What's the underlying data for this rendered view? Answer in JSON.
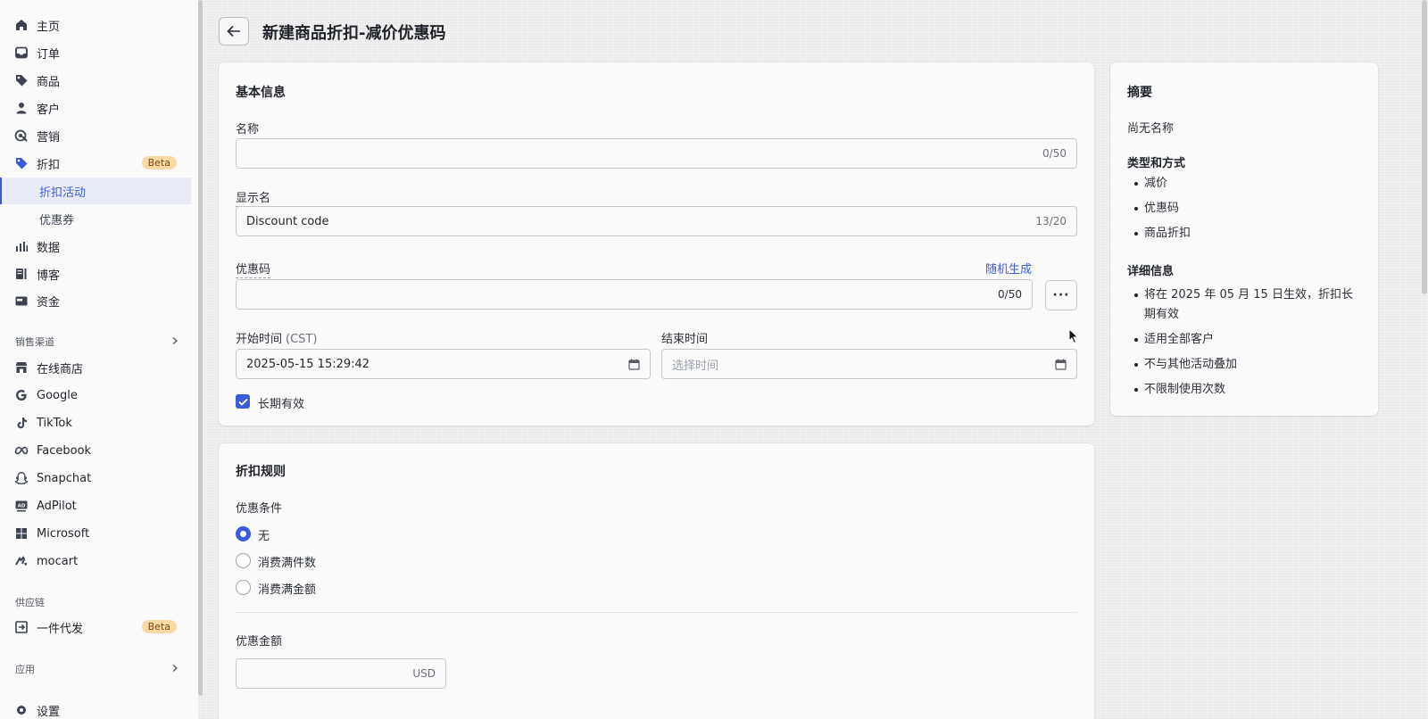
{
  "sidebar": {
    "items": [
      {
        "label": "主页",
        "icon": "home-icon"
      },
      {
        "label": "订单",
        "icon": "inbox-icon"
      },
      {
        "label": "商品",
        "icon": "tag-icon"
      },
      {
        "label": "客户",
        "icon": "person-icon"
      },
      {
        "label": "营销",
        "icon": "target-icon"
      },
      {
        "label": "折扣",
        "icon": "discount-tag-icon",
        "badge": "Beta"
      },
      {
        "label": "折扣活动",
        "active": true
      },
      {
        "label": "优惠券"
      },
      {
        "label": "数据",
        "icon": "bar-chart-icon"
      },
      {
        "label": "博客",
        "icon": "blog-icon"
      },
      {
        "label": "资金",
        "icon": "wallet-icon"
      }
    ],
    "sales_channels_label": "销售渠道",
    "channels": [
      {
        "label": "在线商店",
        "icon": "store-icon"
      },
      {
        "label": "Google",
        "icon": "google-icon"
      },
      {
        "label": "TikTok",
        "icon": "tiktok-icon"
      },
      {
        "label": "Facebook",
        "icon": "meta-icon"
      },
      {
        "label": "Snapchat",
        "icon": "snapchat-icon"
      },
      {
        "label": "AdPilot",
        "icon": "adpilot-icon"
      },
      {
        "label": "Microsoft",
        "icon": "microsoft-icon"
      },
      {
        "label": "mocart",
        "icon": "mocart-icon"
      }
    ],
    "supply_chain_label": "供应链",
    "dropship": {
      "label": "一件代发",
      "badge": "Beta",
      "icon": "dropship-icon"
    },
    "apps_label": "应用",
    "settings_label": "设置"
  },
  "header": {
    "title": "新建商品折扣-减价优惠码"
  },
  "basic_info": {
    "title": "基本信息",
    "name_label": "名称",
    "name_value": "",
    "name_counter": "0/50",
    "display_name_label": "显示名",
    "display_name_value": "Discount code",
    "display_name_counter": "13/20",
    "code_label": "优惠码",
    "code_generate_link": "随机生成",
    "code_value": "",
    "code_counter": "0/50",
    "more_label": "···",
    "start_label": "开始时间",
    "start_tz": "(CST)",
    "start_value": "2025-05-15 15:29:42",
    "end_label": "结束时间",
    "end_placeholder": "选择时间",
    "long_term_label": "长期有效",
    "long_term_checked": true
  },
  "discount_rules": {
    "title": "折扣规则",
    "condition_label": "优惠条件",
    "options": [
      "无",
      "消费满件数",
      "消费满金额"
    ],
    "selected": "无",
    "amount_label": "优惠金额",
    "amount_currency": "USD"
  },
  "summary": {
    "title": "摘要",
    "no_name": "尚无名称",
    "type_heading": "类型和方式",
    "types": [
      "减价",
      "优惠码",
      "商品折扣"
    ],
    "detail_heading": "详细信息",
    "details": [
      "将在 2025 年 05 月 15 日生效，折扣长期有效",
      "适用全部客户",
      "不与其他活动叠加",
      "不限制使用次数"
    ]
  },
  "colors": {
    "accent": "#3b5bdb",
    "beta_badge": "#fcd9a3"
  }
}
